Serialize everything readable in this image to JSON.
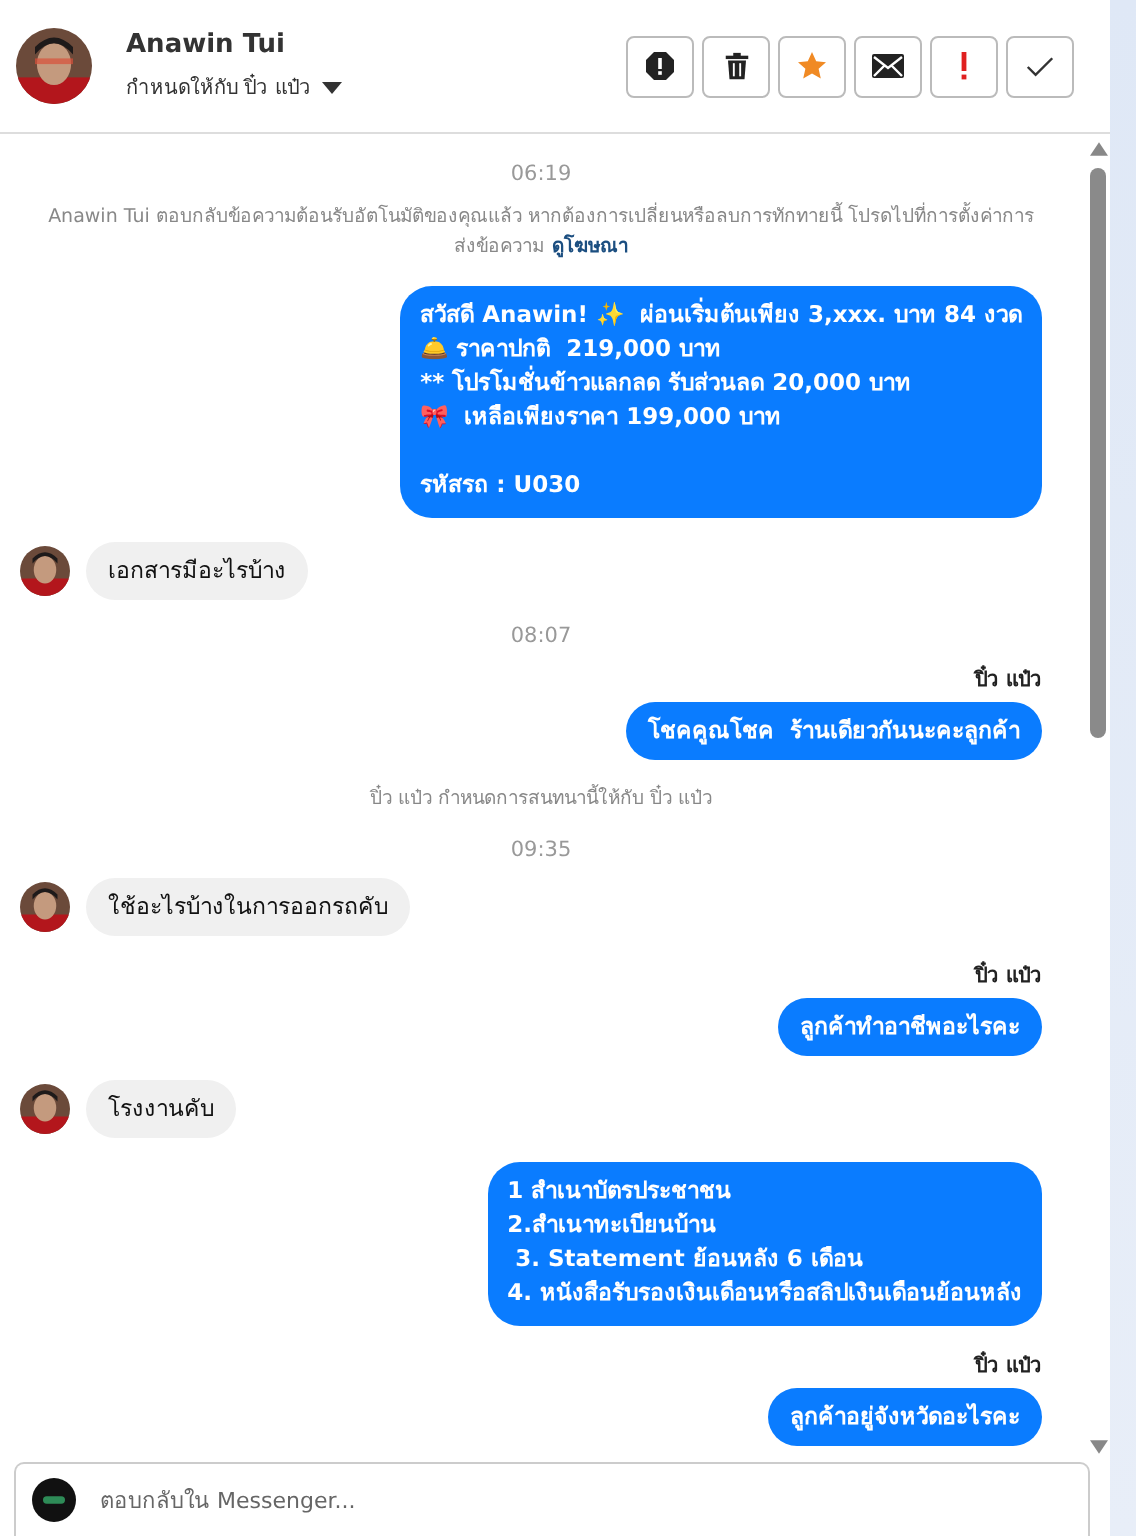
{
  "header": {
    "name": "Anawin Tui",
    "assignee": "กำหนดให้กับ ปิ๋ว แป๋ว",
    "actions": [
      {
        "kind": "spam"
      },
      {
        "kind": "trash"
      },
      {
        "kind": "star"
      },
      {
        "kind": "mail"
      },
      {
        "kind": "important"
      },
      {
        "kind": "done"
      }
    ]
  },
  "messages": [
    {
      "kind": "time",
      "text": "06:19"
    },
    {
      "kind": "notice",
      "text": "Anawin Tui ตอบกลับข้อความต้อนรับอัตโนมัติของคุณแล้ว หากต้องการเปลี่ยนหรือลบการทักทายนี้ โปรดไปที่การตั้งค่าการส่งข้อความ",
      "link": "ดูโฆษณา"
    },
    {
      "kind": "outgoing",
      "lines": [
        "สวัสดี Anawin! ✨  ผ่อนเริ่มต้นเพียง 3,xxx. บาท 84 งวด",
        "🛎️ ราคาปกติ  219,000 บาท",
        "** โปรโมชั่นข้าวแลกลด รับส่วนลด 20,000 บาท",
        "🎀  เหลือเพียงราคา 199,000 บาท"
      ],
      "code": "รหัสรถ : U030"
    },
    {
      "kind": "incoming",
      "lines": [
        "เอกสารมีอะไรบ้าง"
      ]
    },
    {
      "kind": "time",
      "text": "08:07"
    },
    {
      "kind": "outgoing",
      "sender": "ปิ๋ว แป๋ว",
      "lines": [
        "โชคคูณโชค  ร้านเดียวกันนะคะลูกค้า"
      ]
    },
    {
      "kind": "notice",
      "text": "ปิ๋ว แป๋ว กำหนดการสนทนานี้ให้กับ ปิ๋ว แป๋ว"
    },
    {
      "kind": "time",
      "text": "09:35"
    },
    {
      "kind": "incoming",
      "lines": [
        "ใช้อะไรบ้างในการออกรถคับ"
      ]
    },
    {
      "kind": "outgoing",
      "sender": "ปิ๋ว แป๋ว",
      "lines": [
        "ลูกค้าทำอาชีพอะไรคะ"
      ]
    },
    {
      "kind": "incoming",
      "lines": [
        "โรงงานคับ"
      ]
    },
    {
      "kind": "outgoing",
      "lines": [
        "1 สำเนาบัตรประชาชน",
        "2.สำเนาทะเบียนบ้าน",
        " 3. Statement ย้อนหลัง 6 เดือน",
        "4. หนังสือรับรองเงินเดือนหรือสลิปเงินเดือนย้อนหลัง"
      ]
    },
    {
      "kind": "outgoing",
      "sender": "ปิ๋ว แป๋ว",
      "lines": [
        "ลูกค้าอยู่จังหวัดอะไรคะ"
      ]
    }
  ],
  "composer": {
    "placeholder": "ตอบกลับใน Messenger..."
  }
}
